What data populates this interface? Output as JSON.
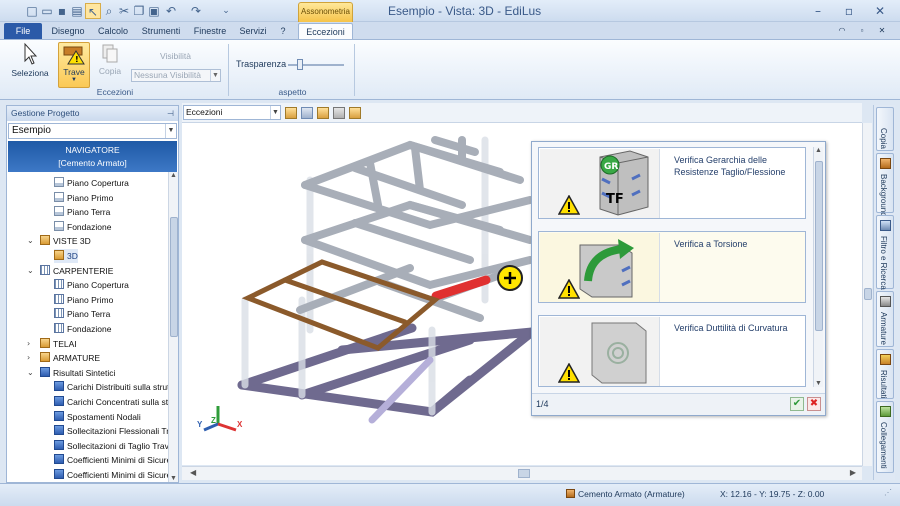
{
  "window": {
    "title": "Esempio - Vista: 3D - EdiLus",
    "context_tab": "Assonometria"
  },
  "ribbon_tabs": [
    "File",
    "Disegno",
    "Calcolo",
    "Strumenti",
    "Finestre",
    "Servizi",
    "?",
    "Eccezioni"
  ],
  "ribbon": {
    "seleziona": "Seleziona",
    "trave": "Trave",
    "copia": "Copia",
    "visibilita_label": "Visibilità",
    "visibilita_value": "Nessuna Visibilità",
    "group_eccezioni": "Eccezioni",
    "trasparenza": "Trasparenza",
    "group_aspetto": "aspetto",
    "trasparenza_level": 0.22
  },
  "left_panel": {
    "title": "Gestione Progetto",
    "project": "Esempio",
    "nav_line1": "NAVIGATORE",
    "nav_line2": "[Cemento Armato]",
    "tree": [
      {
        "label": "Piano Copertura",
        "indent": 2,
        "icon": "doc"
      },
      {
        "label": "Piano Primo",
        "indent": 2,
        "icon": "doc"
      },
      {
        "label": "Piano Terra",
        "indent": 2,
        "icon": "doc"
      },
      {
        "label": "Fondazione",
        "indent": 2,
        "icon": "doc"
      },
      {
        "label": "VISTE 3D",
        "indent": 1,
        "icon": "fold",
        "exp": "⌄"
      },
      {
        "label": "3D",
        "indent": 2,
        "icon": "fold",
        "selected": true
      },
      {
        "label": "CARPENTERIE",
        "indent": 1,
        "icon": "grid",
        "exp": "⌄"
      },
      {
        "label": "Piano Copertura",
        "indent": 2,
        "icon": "grid"
      },
      {
        "label": "Piano Primo",
        "indent": 2,
        "icon": "grid"
      },
      {
        "label": "Piano Terra",
        "indent": 2,
        "icon": "grid"
      },
      {
        "label": "Fondazione",
        "indent": 2,
        "icon": "grid"
      },
      {
        "label": "TELAI",
        "indent": 1,
        "icon": "fold",
        "exp": "›"
      },
      {
        "label": "ARMATURE",
        "indent": 1,
        "icon": "fold",
        "exp": "›"
      },
      {
        "label": "Risultati Sintetici",
        "indent": 1,
        "icon": "res",
        "exp": "⌄"
      },
      {
        "label": "Carichi Distribuiti sulla struttu",
        "indent": 2,
        "icon": "res"
      },
      {
        "label": "Carichi Concentrati sulla strut",
        "indent": 2,
        "icon": "res"
      },
      {
        "label": "Spostamenti Nodali",
        "indent": 2,
        "icon": "res"
      },
      {
        "label": "Sollecitazioni Flessionali Travi",
        "indent": 2,
        "icon": "res"
      },
      {
        "label": "Sollecitazioni di Taglio Travi e",
        "indent": 2,
        "icon": "res"
      },
      {
        "label": "Coefficienti Minimi di Sicurezz",
        "indent": 2,
        "icon": "res"
      },
      {
        "label": "Coefficienti Minimi di Sicurezz",
        "indent": 2,
        "icon": "res"
      }
    ]
  },
  "view_toolbar": {
    "combo": "Eccezioni"
  },
  "popup": {
    "cards": [
      {
        "text": "Verifica Gerarchia delle Resistenze Taglio/Flessione",
        "badge_gr": "GR",
        "badge_tf": "TF"
      },
      {
        "text": "Verifica a Torsione"
      },
      {
        "text": "Verifica Duttilità di Curvatura"
      }
    ],
    "page": "1/4"
  },
  "right_tabs": [
    "Copia",
    "Background",
    "Filtro e Ricerca",
    "Armature",
    "Risultati",
    "Collegamenti"
  ],
  "axes": {
    "x": "X",
    "y": "Y",
    "z": "Z"
  },
  "status": {
    "mode": "Cemento Armato (Armature)",
    "coords": "X: 12.16 - Y: 19.75 - Z: 0.00"
  },
  "colors": {
    "accent": "#2b5aa8",
    "nav": "#2f68b6",
    "highlight_beam": "#e03030",
    "selected_frame": "#8b5a2b"
  }
}
